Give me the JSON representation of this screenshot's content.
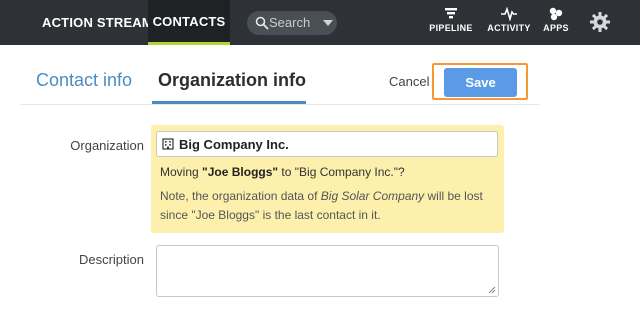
{
  "nav": {
    "action_stream": "ACTION STREAM",
    "contacts": "CONTACTS",
    "search_placeholder": "Search",
    "pipeline": "PIPELINE",
    "activity": "ACTIVITY",
    "apps": "APPS",
    "icons": [
      "search-icon",
      "chevron-down-icon",
      "funnel-icon",
      "pulse-icon",
      "apps-icon",
      "gear-icon"
    ],
    "accent_color": "#b6d438"
  },
  "tabs": {
    "contact_info": "Contact info",
    "organization_info": "Organization info",
    "active": "Organization info"
  },
  "actions": {
    "cancel": "Cancel",
    "save": "Save",
    "save_color": "#5b9be6",
    "highlight_color": "#f59a2e"
  },
  "form": {
    "organization_label": "Organization",
    "organization_value": "Big Company Inc.",
    "move_prefix": "Moving ",
    "move_contact": "\"Joe Bloggs\"",
    "move_suffix": " to \"Big Company Inc.\"?",
    "note_prefix": "Note, the organization data of ",
    "note_org": "Big Solar Company",
    "note_suffix": " will be lost since \"Joe Bloggs\" is the last contact in it.",
    "description_label": "Description",
    "description_value": "",
    "warning_bg": "#fdf0ad"
  }
}
